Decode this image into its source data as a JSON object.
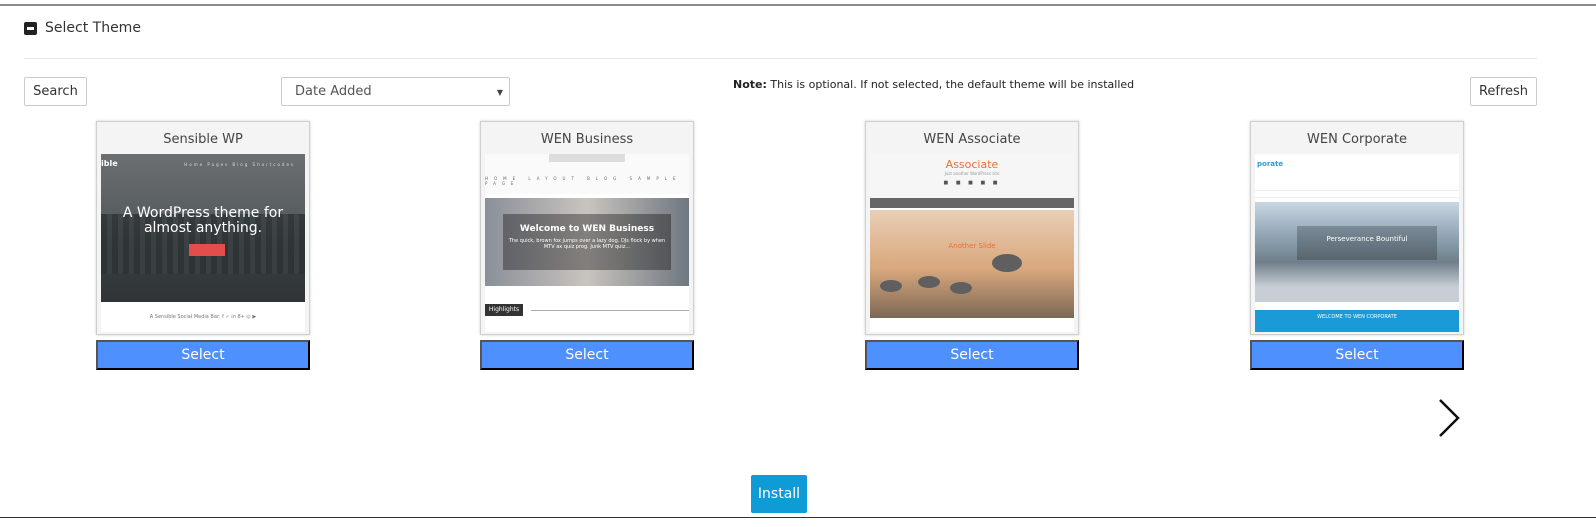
{
  "section": {
    "title": "Select Theme",
    "icon": "collapse-icon"
  },
  "toolbar": {
    "search_label": "Search",
    "sort_selected": "Date Added",
    "note_bold": "Note:",
    "note_text": " This is optional. If not selected, the default theme will be installed",
    "refresh_label": "Refresh"
  },
  "themes": [
    {
      "title": "Sensible WP",
      "select_label": "Select",
      "preview": {
        "logo": "ible",
        "nav": "Home Pages Blog Shortcodes",
        "hero": "A WordPress theme for almost anything.",
        "footer": "A Sensible Social Media Bar:  f  ✓  in  8+  ◎  ▶"
      }
    },
    {
      "title": "WEN Business",
      "select_label": "Select",
      "preview": {
        "nav": "HOME LAYOUT BLOG SAMPLE PAGE",
        "hero_heading": "Welcome to WEN Business",
        "hero_text": "The quick, brown fox jumps over a lazy dog. DJs flock by when MTV ax quiz prog. Junk MTV quiz...",
        "tag": "Highlights"
      }
    },
    {
      "title": "WEN Associate",
      "select_label": "Select",
      "preview": {
        "name": "Associate",
        "subtitle": "Just another WordPress site",
        "caption": "Another Slide"
      }
    },
    {
      "title": "WEN Corporate",
      "select_label": "Select",
      "preview": {
        "logo": "porate",
        "hero_heading": "Perseverance Bountiful",
        "band": "WELCOME TO WEN CORPORATE"
      }
    }
  ],
  "pager": {
    "next_icon": "chevron-right-icon"
  },
  "install_label": "Install"
}
